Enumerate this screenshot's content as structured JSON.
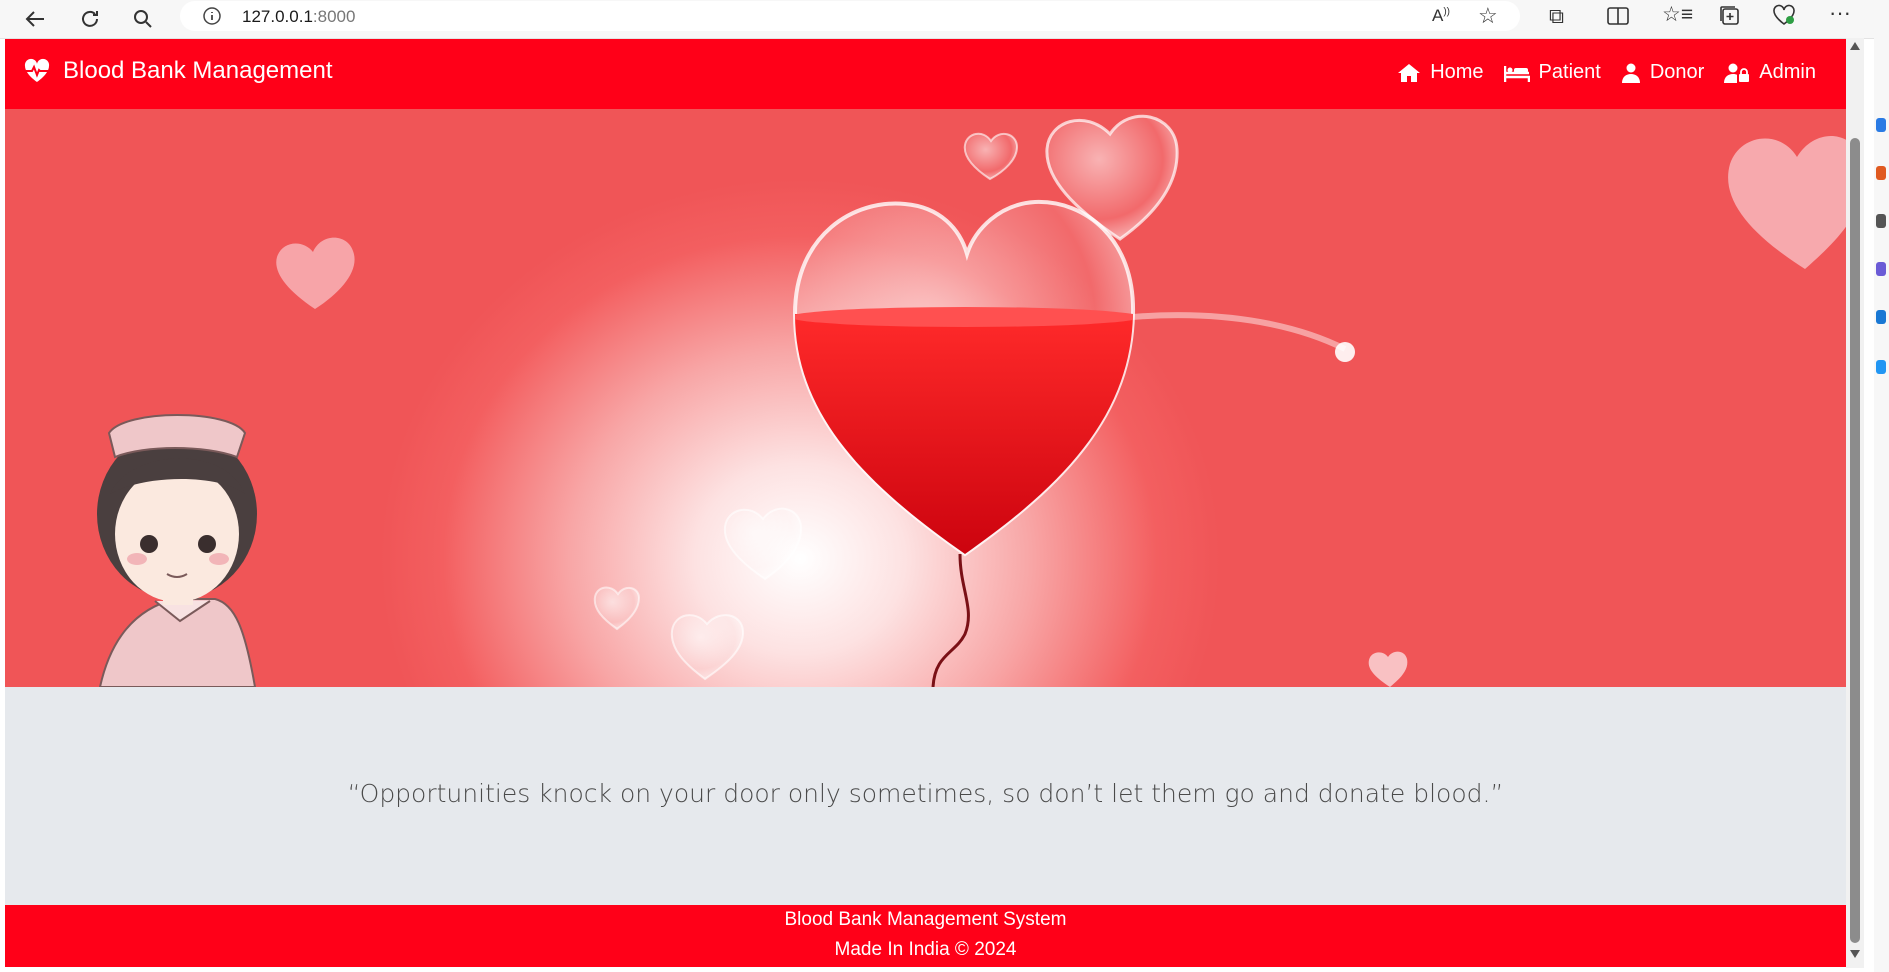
{
  "browser": {
    "url_host": "127.0.0.1",
    "url_port": ":8000",
    "icons": [
      "back-icon",
      "reload-icon",
      "search-icon",
      "info-icon",
      "read-aloud-icon",
      "favorite-star-icon",
      "extensions-icon",
      "split-screen-icon",
      "favorites-icon",
      "collections-icon",
      "health-icon",
      "more-icon"
    ]
  },
  "navbar": {
    "brand": "Blood Bank Management",
    "links": [
      {
        "label": "Home",
        "icon": "home-icon"
      },
      {
        "label": "Patient",
        "icon": "bed-icon"
      },
      {
        "label": "Donor",
        "icon": "user-icon"
      },
      {
        "label": "Admin",
        "icon": "user-lock-icon"
      }
    ],
    "color": "#ff0018"
  },
  "quote": "“Opportunities knock on your door only sometimes, so don’t let them go and donate blood.”",
  "footer": {
    "line1": "Blood Bank Management System",
    "line2": "Made In India © 2024"
  }
}
